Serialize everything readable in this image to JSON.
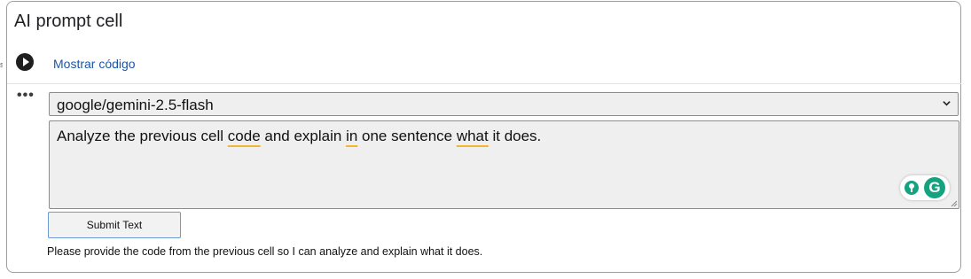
{
  "cell": {
    "title": "AI prompt cell",
    "show_code_label": "Mostrar código",
    "more_label": "•••",
    "left_edge_mark": "s",
    "model_select": {
      "value": "google/gemini-2.5-flash"
    },
    "prompt": {
      "parts": [
        "Analyze the previous cell ",
        "code",
        " and explain ",
        "in",
        " one sentence ",
        "what",
        " it does."
      ]
    },
    "assistant_icon_letter": "G",
    "submit_label": "Submit Text",
    "response_text": "Please provide the code from the previous cell so I can analyze and explain what it does."
  },
  "colors": {
    "link": "#1a56a8",
    "grammar_green": "#15a37f",
    "squiggle": "#f2b632"
  },
  "icons": [
    "play-icon",
    "more-options-icon",
    "chevron-down-icon",
    "lightbulb-icon",
    "grammarly-icon",
    "resize-handle-icon"
  ]
}
